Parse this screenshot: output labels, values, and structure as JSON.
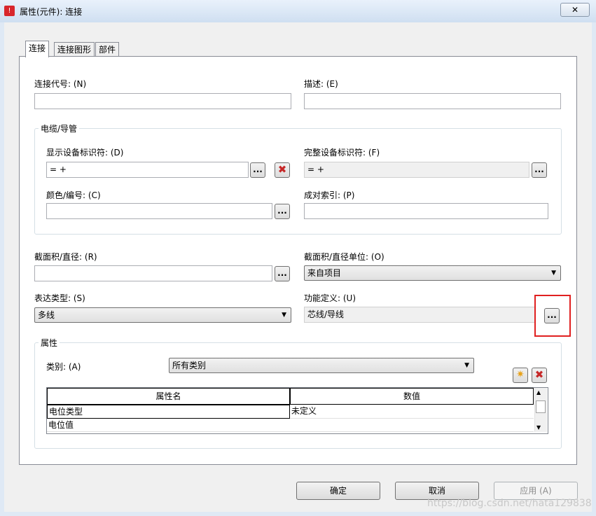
{
  "window": {
    "title": "属性(元件): 连接",
    "close_symbol": "✕",
    "app_icon": "warning-icon"
  },
  "tabs": [
    {
      "label": "连接",
      "active": true
    },
    {
      "label": "连接图形",
      "active": false
    },
    {
      "label": "部件",
      "active": false
    }
  ],
  "fields": {
    "connection_code": {
      "label": "连接代号: (N)",
      "value": ""
    },
    "description": {
      "label": "描述: (E)",
      "value": ""
    },
    "cable_group_title": "电缆/导管",
    "display_device_id": {
      "label": "显示设备标识符: (D)",
      "value": "= +"
    },
    "full_device_id": {
      "label": "完整设备标识符: (F)",
      "value": "= +"
    },
    "color_number": {
      "label": "颜色/编号: (C)",
      "value": ""
    },
    "pair_index": {
      "label": "成对索引: (P)",
      "value": ""
    },
    "cross_section": {
      "label": "截面积/直径: (R)",
      "value": ""
    },
    "cross_section_unit": {
      "label": "截面积/直径单位: (O)",
      "value": "来自项目"
    },
    "representation_type": {
      "label": "表达类型: (S)",
      "value": "多线"
    },
    "function_definition": {
      "label": "功能定义: (U)",
      "value": "芯线/导线"
    }
  },
  "buttons": {
    "ellipsis": "...",
    "delete": "✖",
    "new": "✷"
  },
  "properties": {
    "group_title": "属性",
    "category_label": "类别: (A)",
    "category_value": "所有类别",
    "columns": [
      "属性名",
      "数值"
    ],
    "rows": [
      {
        "name": "电位类型",
        "value": "未定义"
      },
      {
        "name": "电位值",
        "value": ""
      }
    ]
  },
  "dialog_buttons": {
    "ok": "确定",
    "cancel": "取消",
    "apply": "应用 (A)"
  },
  "watermark": "https://blog.csdn.net/hata129838",
  "colors": {
    "highlight": "#e02020",
    "delete": "#c62828"
  }
}
